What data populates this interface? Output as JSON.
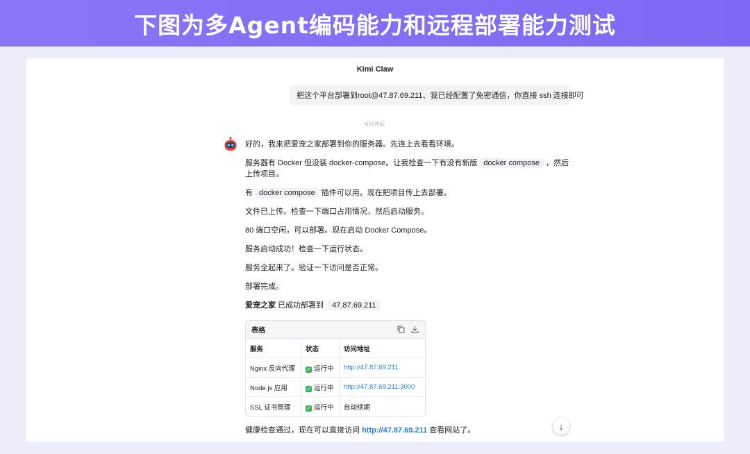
{
  "banner": {
    "title": "下图为多Agent编码能力和远程部署能力测试"
  },
  "chat": {
    "title": "Kimi Claw",
    "user_message": "把这个平台部署到root@47.87.69.211、我已经配置了免密通信，你直接 ssh 连接即可",
    "time_divider": "6分钟前",
    "reply": {
      "p1": "好的，我来把爱宠之家部署到你的服务器。先连上去看看环境。",
      "p2a": "服务器有 Docker 但没装 docker-compose。让我检查一下有没有新版",
      "p2code": "docker compose",
      "p2b": "，然后上传项目。",
      "p3a": "有",
      "p3code": "docker compose",
      "p3b": "插件可以用。现在把项目传上去部署。",
      "p4": "文件已上传。检查一下端口占用情况，然后启动服务。",
      "p5": "80 端口空闲，可以部署。现在启动 Docker Compose。",
      "p6": "服务启动成功！检查一下运行状态。",
      "p7": "服务全起来了。验证一下访问是否正常。",
      "p8": "部署完成。",
      "p9bold": "爱宠之家",
      "p9text": "已成功部署到",
      "p9code": "47.87.69.211"
    },
    "table": {
      "label": "表格",
      "headers": [
        "服务",
        "状态",
        "访问地址"
      ],
      "rows": [
        {
          "service": "Nginx 反向代理",
          "status": "运行中",
          "address": "http://47.87.69.211",
          "is_link": true
        },
        {
          "service": "Node.js 应用",
          "status": "运行中",
          "address": "http://47.87.69.211:3000",
          "is_link": true
        },
        {
          "service": "SSL 证书管理",
          "status": "运行中",
          "address": "自动续期",
          "is_link": false
        }
      ]
    },
    "final_a": "健康检查通过，现在可以直接访问",
    "final_link": "http://47.87.69.211",
    "final_b": "查看网站了。"
  },
  "colors": {
    "banner": "#8a74f7",
    "link": "#2a7fd4",
    "status_ok": "#3cb35a"
  },
  "icons": [
    "robot-avatar-icon",
    "copy-icon",
    "download-icon",
    "check-icon",
    "arrow-down-icon"
  ]
}
